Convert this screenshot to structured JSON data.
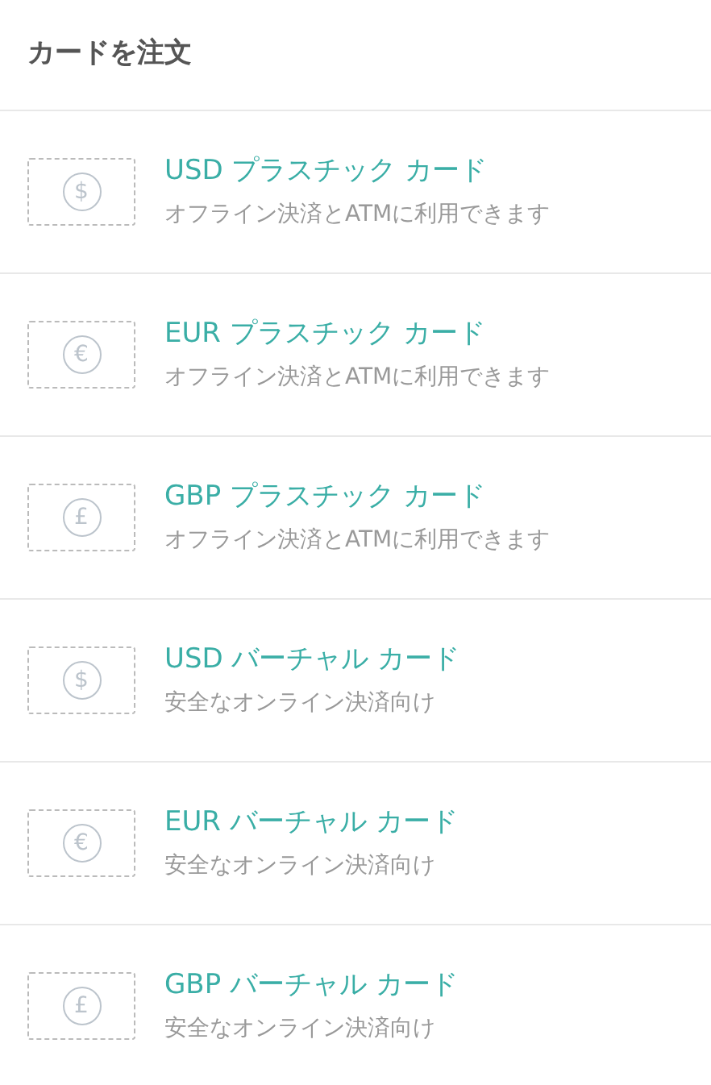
{
  "title": "カードを注文",
  "cards": [
    {
      "symbol": "$",
      "name": "USD プラスチック カード",
      "description": "オフライン決済とATMに利用できます"
    },
    {
      "symbol": "€",
      "name": "EUR プラスチック カード",
      "description": "オフライン決済とATMに利用できます"
    },
    {
      "symbol": "£",
      "name": "GBP プラスチック カード",
      "description": "オフライン決済とATMに利用できます"
    },
    {
      "symbol": "$",
      "name": "USD バーチャル カード",
      "description": "安全なオンライン決済向け"
    },
    {
      "symbol": "€",
      "name": "EUR バーチャル カード",
      "description": "安全なオンライン決済向け"
    },
    {
      "symbol": "£",
      "name": "GBP バーチャル カード",
      "description": "安全なオンライン決済向け"
    }
  ]
}
